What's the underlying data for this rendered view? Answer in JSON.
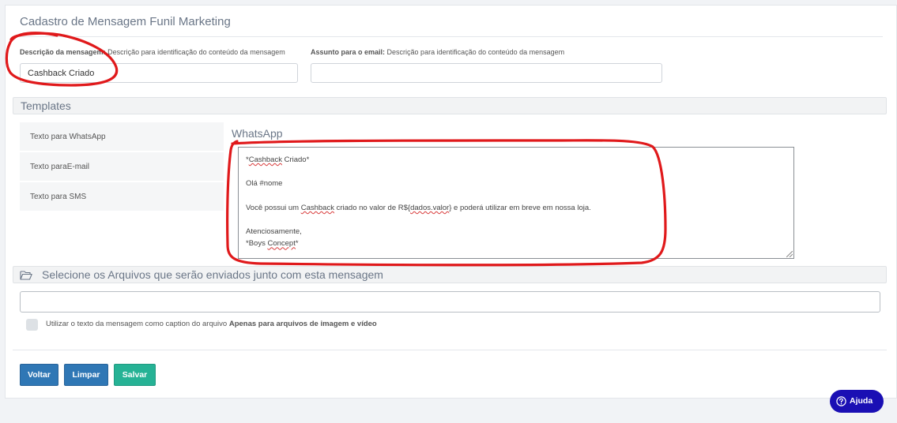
{
  "page": {
    "title": "Cadastro de Mensagem Funil Marketing"
  },
  "form": {
    "description": {
      "label": "Descrição da mensagem:",
      "hint": "Descrição para identificação do conteúdo da mensagem",
      "value": "Cashback Criado"
    },
    "subject": {
      "label": "Assunto para o email:",
      "hint": "Descrição para identificação do conteúdo da mensagem",
      "value": ""
    }
  },
  "templates": {
    "section_title": "Templates",
    "tabs": [
      {
        "label": "Texto para WhatsApp"
      },
      {
        "label": "Texto paraE-mail"
      },
      {
        "label": "Texto para SMS"
      }
    ],
    "active_title": "WhatsApp",
    "editor_lines": [
      [
        "*",
        "Cashback",
        " Criado*"
      ],
      [
        "",
        "",
        ""
      ],
      [
        "Olá #nome",
        "",
        ""
      ],
      [
        "",
        "",
        ""
      ],
      [
        "Você possui um ",
        "Cashback",
        " criado no valor de R${",
        "dados.valor",
        "} e poderá utilizar em breve em nossa loja."
      ],
      [
        "",
        "",
        ""
      ],
      [
        "Atenciosamente,",
        "",
        ""
      ],
      [
        "*Boys ",
        "Concept",
        "*"
      ]
    ]
  },
  "files": {
    "section_title": "Selecione os Arquivos que serão enviados junto com esta mensagem",
    "caption_label": "Utilizar o texto da mensagem como caption do arquivo",
    "caption_bold": "Apenas para arquivos de imagem e vídeo",
    "caption_checked": false
  },
  "actions": {
    "back_label": "Voltar",
    "clear_label": "Limpar",
    "save_label": "Salvar"
  },
  "help": {
    "label": "Ajuda"
  },
  "colors": {
    "primary": "#2f77b5",
    "success": "#26b295",
    "help": "#1a0fb4",
    "annotation": "#e0191b"
  }
}
